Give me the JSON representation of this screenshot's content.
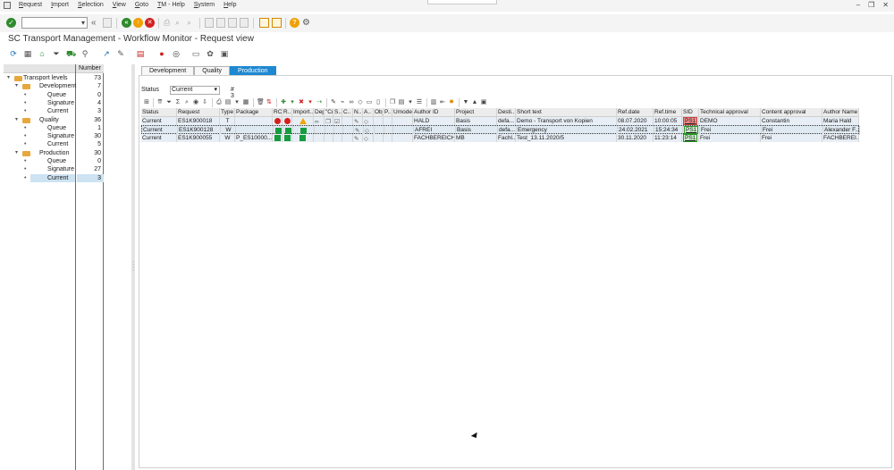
{
  "menubar": {
    "items": [
      "Request",
      "Import",
      "Selection",
      "View",
      "Goto",
      "TM - Help",
      "System",
      "Help"
    ]
  },
  "app": {
    "title": "SC Transport Management - Workflow Monitor - Request view"
  },
  "tree": {
    "column_header": "Number",
    "rows": [
      {
        "label": "Transport levels",
        "count": "73"
      },
      {
        "label": "Development",
        "count": "7"
      },
      {
        "label": "Queue",
        "count": "0"
      },
      {
        "label": "Signature",
        "count": "4"
      },
      {
        "label": "Current",
        "count": "3"
      },
      {
        "label": "Quality",
        "count": "36"
      },
      {
        "label": "Queue",
        "count": "1"
      },
      {
        "label": "Signature",
        "count": "30"
      },
      {
        "label": "Current",
        "count": "5"
      },
      {
        "label": "Production",
        "count": "30"
      },
      {
        "label": "Queue",
        "count": "0"
      },
      {
        "label": "Signature",
        "count": "27"
      },
      {
        "label": "Current",
        "count": "3"
      }
    ]
  },
  "tabs": [
    "Development",
    "Quality",
    "Production"
  ],
  "active_tab": "Production",
  "status_filter": {
    "label": "Status",
    "value": "Current",
    "count_text": "# 3"
  },
  "grid": {
    "headers": [
      "Status",
      "Request",
      "Type",
      "Package",
      "RC",
      "R..",
      "Import..",
      "Dep..",
      "\"Cr",
      "S..",
      "C..",
      "N..",
      "A..",
      "Obj",
      "P..",
      "Umode",
      "Author ID",
      "Project",
      "Desti..",
      "Short text",
      "Ref.date",
      "Ref.time",
      "SID",
      "Technical approval",
      "Content approval",
      "Author Name"
    ],
    "rows": [
      {
        "status": "Current",
        "request": "ES1K900018",
        "type": "T",
        "package": "",
        "author_id": "HALD",
        "project": "Basis",
        "dest": "defa...",
        "short_text": "Demo - Transport von Kopien",
        "ref_date": "08.07.2020",
        "ref_time": "10:00:05",
        "sid": "PS1",
        "tech": "DEMO",
        "content": "Constantin",
        "author_name": "Maria Hald"
      },
      {
        "status": "Current",
        "request": "ES1K900128",
        "type": "W",
        "package": "",
        "author_id": "AFREI",
        "project": "Basis",
        "dest": "defa...",
        "short_text": "Emergency",
        "ref_date": "24.02.2021",
        "ref_time": "15:24:34",
        "sid": "PS1",
        "tech": "Frei",
        "content": "Frei",
        "author_name": "Alexander F..."
      },
      {
        "status": "Current",
        "request": "ES1K900055",
        "type": "W",
        "package": "P_ES10000...",
        "author_id": "FACHBEREICH",
        "project": "MB",
        "dest": "Fachl...",
        "short_text": "Test_13.11.2020/5",
        "ref_date": "30.11.2020",
        "ref_time": "11:23:14",
        "sid": "PS1",
        "tech": "Frei",
        "content": "Frei",
        "author_name": "FACHBEREI..."
      }
    ]
  },
  "colors": {
    "accent": "#1e88d1",
    "lamp_red": "#d61d1d",
    "lamp_green": "#179b3f",
    "warning": "#f0a800",
    "folder": "#e8a73d"
  }
}
